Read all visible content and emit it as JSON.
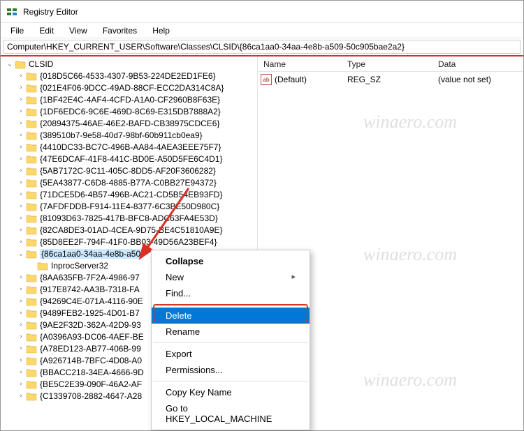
{
  "title": "Registry Editor",
  "menu": {
    "file": "File",
    "edit": "Edit",
    "view": "View",
    "favorites": "Favorites",
    "help": "Help"
  },
  "address": "Computer\\HKEY_CURRENT_USER\\Software\\Classes\\CLSID\\{86ca1aa0-34aa-4e8b-a509-50c905bae2a2}",
  "list": {
    "headers": {
      "name": "Name",
      "type": "Type",
      "data": "Data"
    },
    "rows": [
      {
        "icon": "ab",
        "name": "(Default)",
        "type": "REG_SZ",
        "data": "(value not set)"
      }
    ]
  },
  "tree": [
    {
      "depth": 0,
      "exp": "open",
      "label": "CLSID",
      "sel": false
    },
    {
      "depth": 1,
      "exp": "closed",
      "label": "{018D5C66-4533-4307-9B53-224DE2ED1FE6}",
      "sel": false
    },
    {
      "depth": 1,
      "exp": "closed",
      "label": "{021E4F06-9DCC-49AD-88CF-ECC2DA314C8A}",
      "sel": false
    },
    {
      "depth": 1,
      "exp": "closed",
      "label": "{1BF42E4C-4AF4-4CFD-A1A0-CF2960B8F63E}",
      "sel": false
    },
    {
      "depth": 1,
      "exp": "closed",
      "label": "{1DF6EDC6-9C6E-469D-8C69-E315DB7888A2}",
      "sel": false
    },
    {
      "depth": 1,
      "exp": "closed",
      "label": "{20894375-46AE-46E2-BAFD-CB38975CDCE6}",
      "sel": false
    },
    {
      "depth": 1,
      "exp": "closed",
      "label": "{389510b7-9e58-40d7-98bf-60b911cb0ea9}",
      "sel": false
    },
    {
      "depth": 1,
      "exp": "closed",
      "label": "{4410DC33-BC7C-496B-AA84-4AEA3EEE75F7}",
      "sel": false
    },
    {
      "depth": 1,
      "exp": "closed",
      "label": "{47E6DCAF-41F8-441C-BD0E-A50D5FE6C4D1}",
      "sel": false
    },
    {
      "depth": 1,
      "exp": "closed",
      "label": "{5AB7172C-9C11-405C-8DD5-AF20F3606282}",
      "sel": false
    },
    {
      "depth": 1,
      "exp": "closed",
      "label": "{5EA43877-C6D8-4885-B77A-C0BB27E94372}",
      "sel": false
    },
    {
      "depth": 1,
      "exp": "closed",
      "label": "{71DCE5D6-4B57-496B-AC21-CD5B54EB93FD}",
      "sel": false
    },
    {
      "depth": 1,
      "exp": "closed",
      "label": "{7AFDFDDB-F914-11E4-8377-6C3BE50D980C}",
      "sel": false
    },
    {
      "depth": 1,
      "exp": "closed",
      "label": "{81093D63-7825-417B-BFC8-ADC63FA4E53D}",
      "sel": false
    },
    {
      "depth": 1,
      "exp": "closed",
      "label": "{82CA8DE3-01AD-4CEA-9D75-BE4C51810A9E}",
      "sel": false
    },
    {
      "depth": 1,
      "exp": "closed",
      "label": "{85D8EE2F-794F-41F0-BB03-49D56A23BEF4}",
      "sel": false
    },
    {
      "depth": 1,
      "exp": "open",
      "label": "{86ca1aa0-34aa-4e8b-a509-50c905bae2a2}",
      "sel": true,
      "truncated": "{86ca1aa0-34aa-4e8b-a50"
    },
    {
      "depth": 2,
      "exp": "none",
      "label": "InprocServer32",
      "sel": false
    },
    {
      "depth": 1,
      "exp": "closed",
      "label": "{8AA635FB-7F2A-4986-97",
      "sel": false
    },
    {
      "depth": 1,
      "exp": "closed",
      "label": "{917E8742-AA3B-7318-FA",
      "sel": false
    },
    {
      "depth": 1,
      "exp": "closed",
      "label": "{94269C4E-071A-4116-90E",
      "sel": false
    },
    {
      "depth": 1,
      "exp": "closed",
      "label": "{9489FEB2-1925-4D01-B7",
      "sel": false
    },
    {
      "depth": 1,
      "exp": "closed",
      "label": "{9AE2F32D-362A-42D9-93",
      "sel": false
    },
    {
      "depth": 1,
      "exp": "closed",
      "label": "{A0396A93-DC06-4AEF-BE",
      "sel": false
    },
    {
      "depth": 1,
      "exp": "closed",
      "label": "{A78ED123-AB77-406B-99",
      "sel": false
    },
    {
      "depth": 1,
      "exp": "closed",
      "label": "{A926714B-7BFC-4D08-A0",
      "sel": false
    },
    {
      "depth": 1,
      "exp": "closed",
      "label": "{BBACC218-34EA-4666-9D",
      "sel": false
    },
    {
      "depth": 1,
      "exp": "closed",
      "label": "{BE5C2E39-090F-46A2-AF",
      "sel": false
    },
    {
      "depth": 1,
      "exp": "closed",
      "label": "{C1339708-2882-4647-A28",
      "sel": false
    }
  ],
  "context_menu": {
    "collapse": "Collapse",
    "new": "New",
    "find": "Find...",
    "delete": "Delete",
    "rename": "Rename",
    "export": "Export",
    "permissions": "Permissions...",
    "copy_key": "Copy Key Name",
    "goto": "Go to HKEY_LOCAL_MACHINE"
  },
  "watermark": "winaero.com"
}
